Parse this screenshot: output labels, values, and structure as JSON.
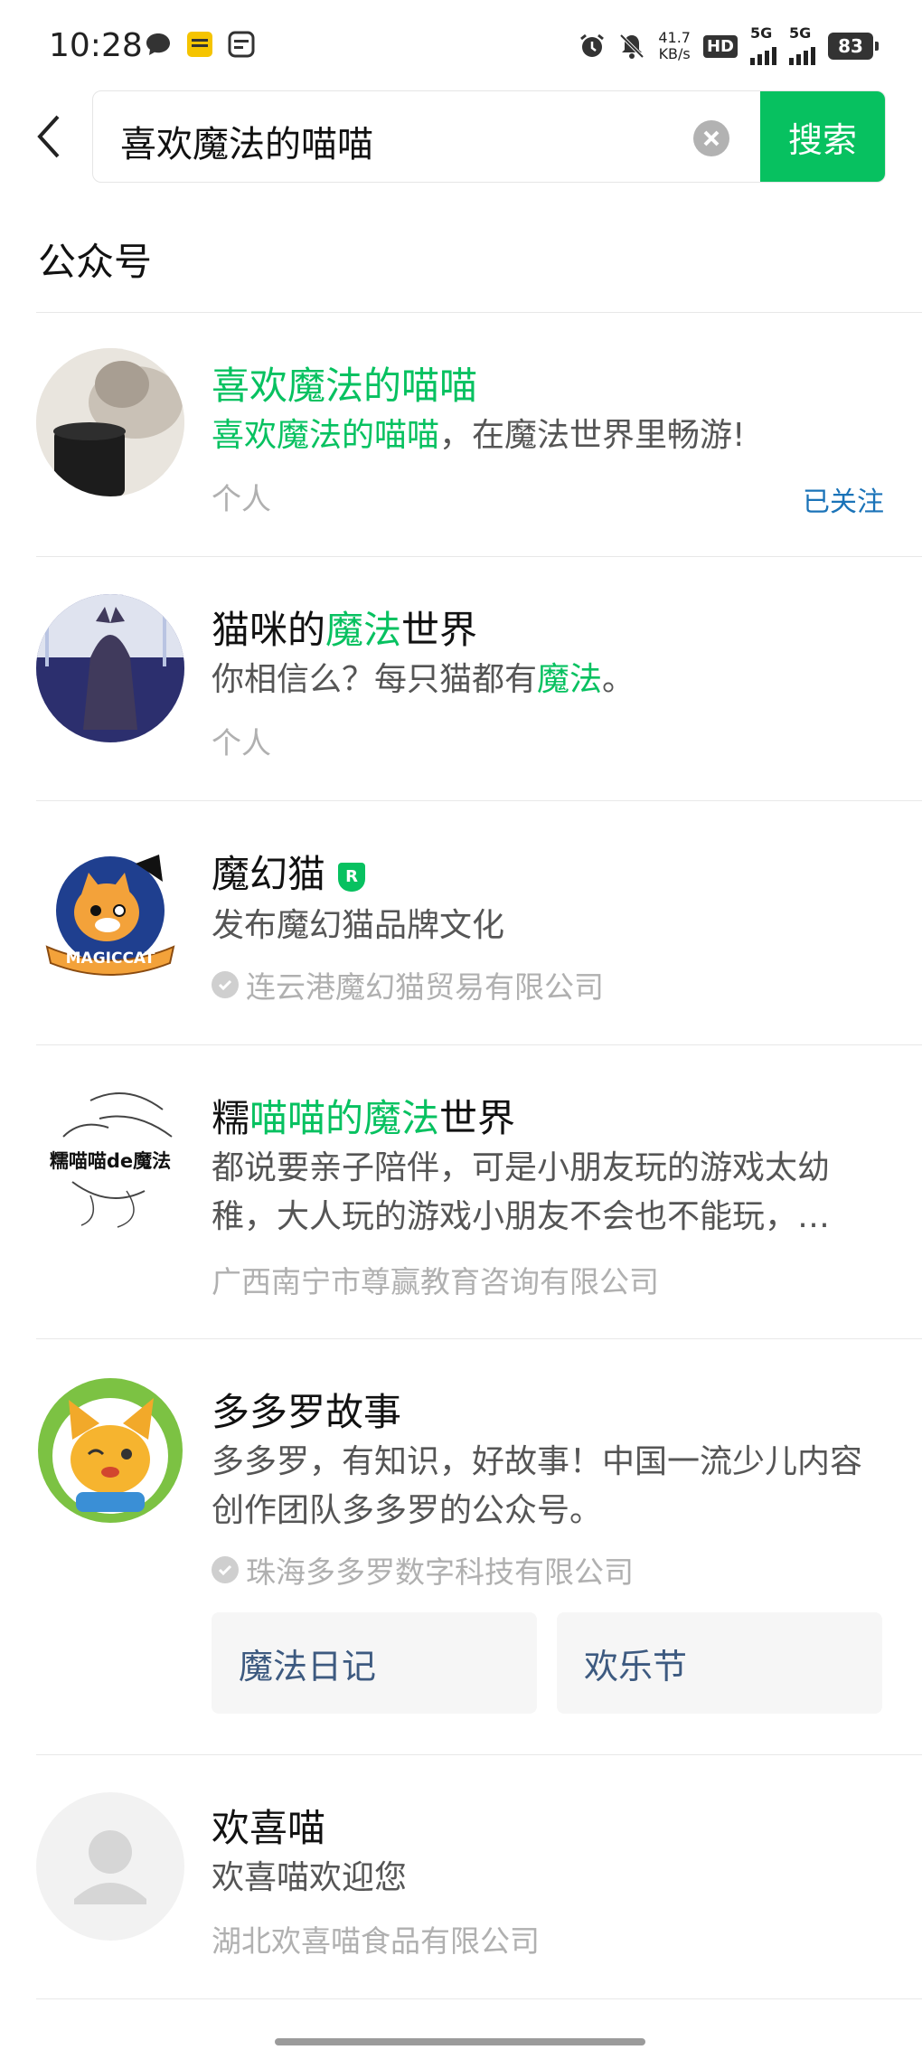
{
  "status_bar": {
    "time": "10:28",
    "net_speed_value": "41.7",
    "net_speed_unit": "KB/s",
    "hd": "HD",
    "sim1": "5G",
    "sim2": "5G",
    "battery": "83"
  },
  "search": {
    "query": "喜欢魔法的喵喵",
    "button": "搜索"
  },
  "section_title": "公众号",
  "results": [
    {
      "title_parts": [
        "",
        "喜欢魔法的喵喵",
        ""
      ],
      "desc_parts": [
        "",
        "喜欢魔法的喵喵",
        "，在魔法世界里畅游!"
      ],
      "sub": "个人",
      "action": "已关注"
    },
    {
      "title_parts": [
        "猫咪的",
        "魔法",
        "世界"
      ],
      "desc_parts": [
        "你相信么？每只猫都有",
        "魔法",
        "。"
      ],
      "sub": "个人"
    },
    {
      "title": "魔幻猫",
      "verified_badge": "R",
      "desc": "发布魔幻猫品牌文化",
      "sub": "连云港魔幻猫贸易有限公司",
      "logo_text": "MAGICCAT"
    },
    {
      "title_parts": [
        "糯",
        "喵喵的魔法",
        "世界"
      ],
      "desc": "都说要亲子陪伴，可是小朋友玩的游戏太幼稚，大人玩的游戏小朋友不会也不能玩，…",
      "sub": "广西南宁市尊赢教育咨询有限公司",
      "logo_text": "糯喵喵de魔法"
    },
    {
      "title": "多多罗故事",
      "desc": "多多罗，有知识，好故事！中国一流少儿内容创作团队多多罗的公众号。",
      "sub": "珠海多多罗数字科技有限公司",
      "tags": [
        "魔法日记",
        "欢乐节"
      ]
    },
    {
      "title": "欢喜喵",
      "desc": "欢喜喵欢迎您",
      "sub": "湖北欢喜喵食品有限公司"
    }
  ],
  "colors": {
    "accent": "#07c160",
    "link": "#1a73b8"
  }
}
